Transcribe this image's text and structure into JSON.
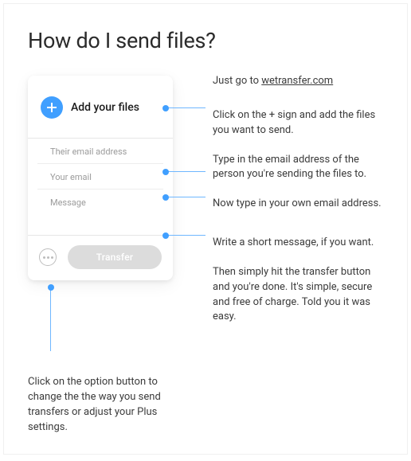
{
  "title": "How do I send files?",
  "card": {
    "add_files_label": "Add your files",
    "field_their_email": "Their email address",
    "field_your_email": "Your email",
    "field_message": "Message",
    "transfer_label": "Transfer"
  },
  "steps": {
    "goto_prefix": "Just go to ",
    "goto_link": "wetransfer.com",
    "click_plus": "Click on the + sign and add the files you want to send.",
    "their_email": "Type in the email address of the person you're sending the files to.",
    "your_email": "Now type in your own email address.",
    "message": "Write a short message, if you want.",
    "transfer": "Then simply hit the transfer button and you're done. It's simple, secure and free of charge.  Told you it was easy."
  },
  "options_caption": "Click on the option button to change the the way you send transfers or adjust your Plus settings."
}
